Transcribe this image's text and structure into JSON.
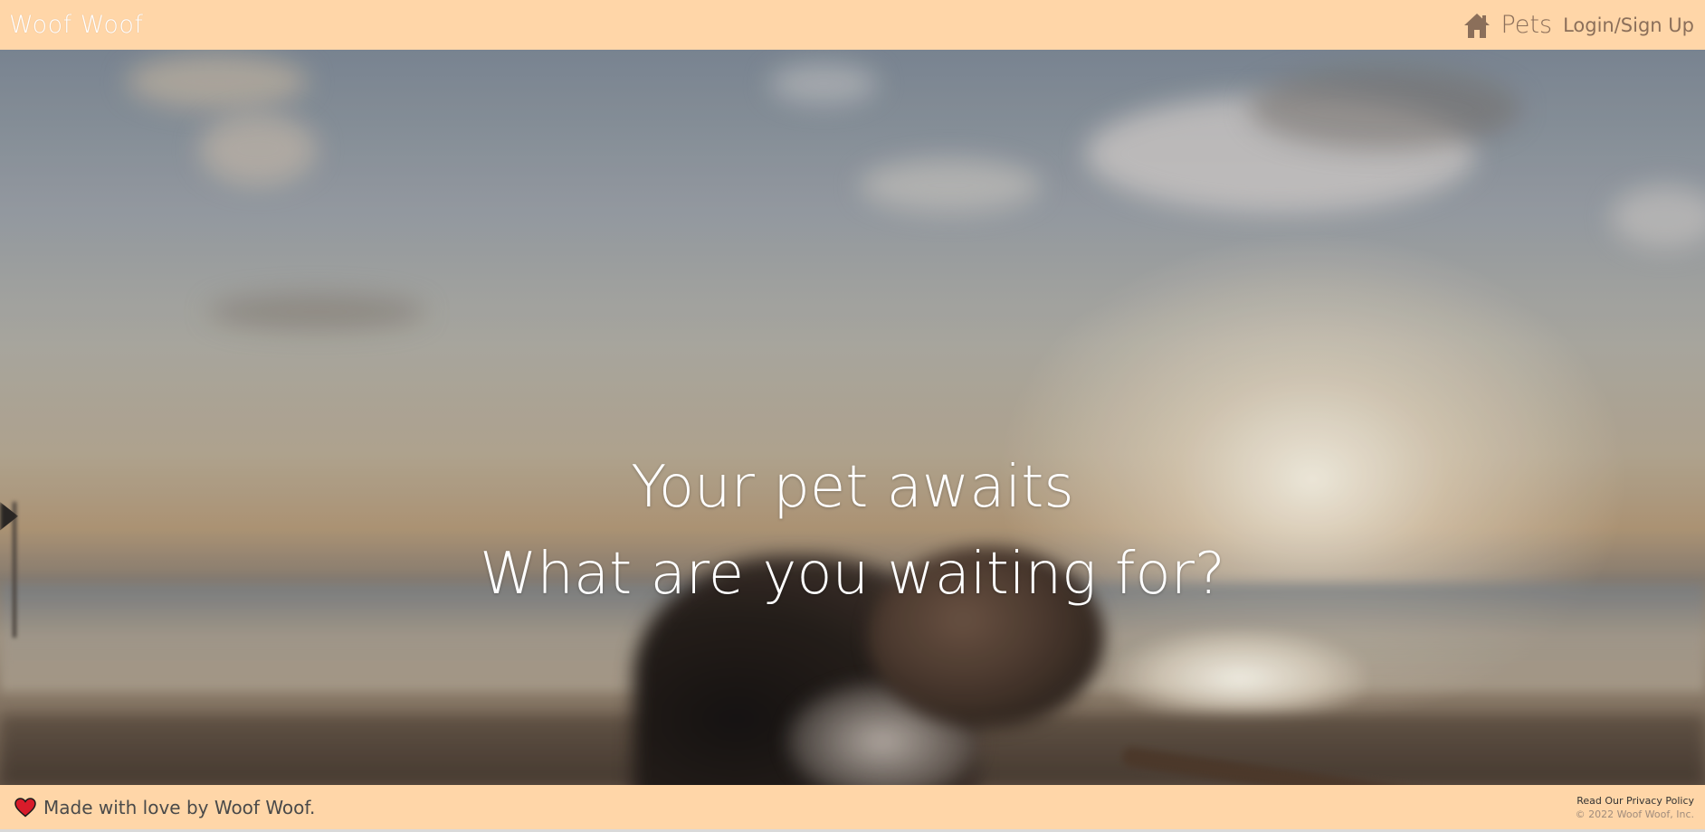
{
  "navbar": {
    "brand": "Woof Woof",
    "home_icon": "home-icon",
    "pets_label": "Pets",
    "login_label": "Login/Sign Up"
  },
  "hero": {
    "line1": "Your pet awaits",
    "line2": "What are you waiting for?"
  },
  "footer": {
    "heart_icon": "heart-icon",
    "made_with": "Made with love by Woof Woof.",
    "privacy_link": "Read Our Privacy Policy",
    "copyright": "© 2022 Woof Woof, Inc."
  },
  "colors": {
    "bar_background": "#ffd6a8",
    "nav_text": "#8b6f5a",
    "heart_fill": "#d81b2a"
  }
}
